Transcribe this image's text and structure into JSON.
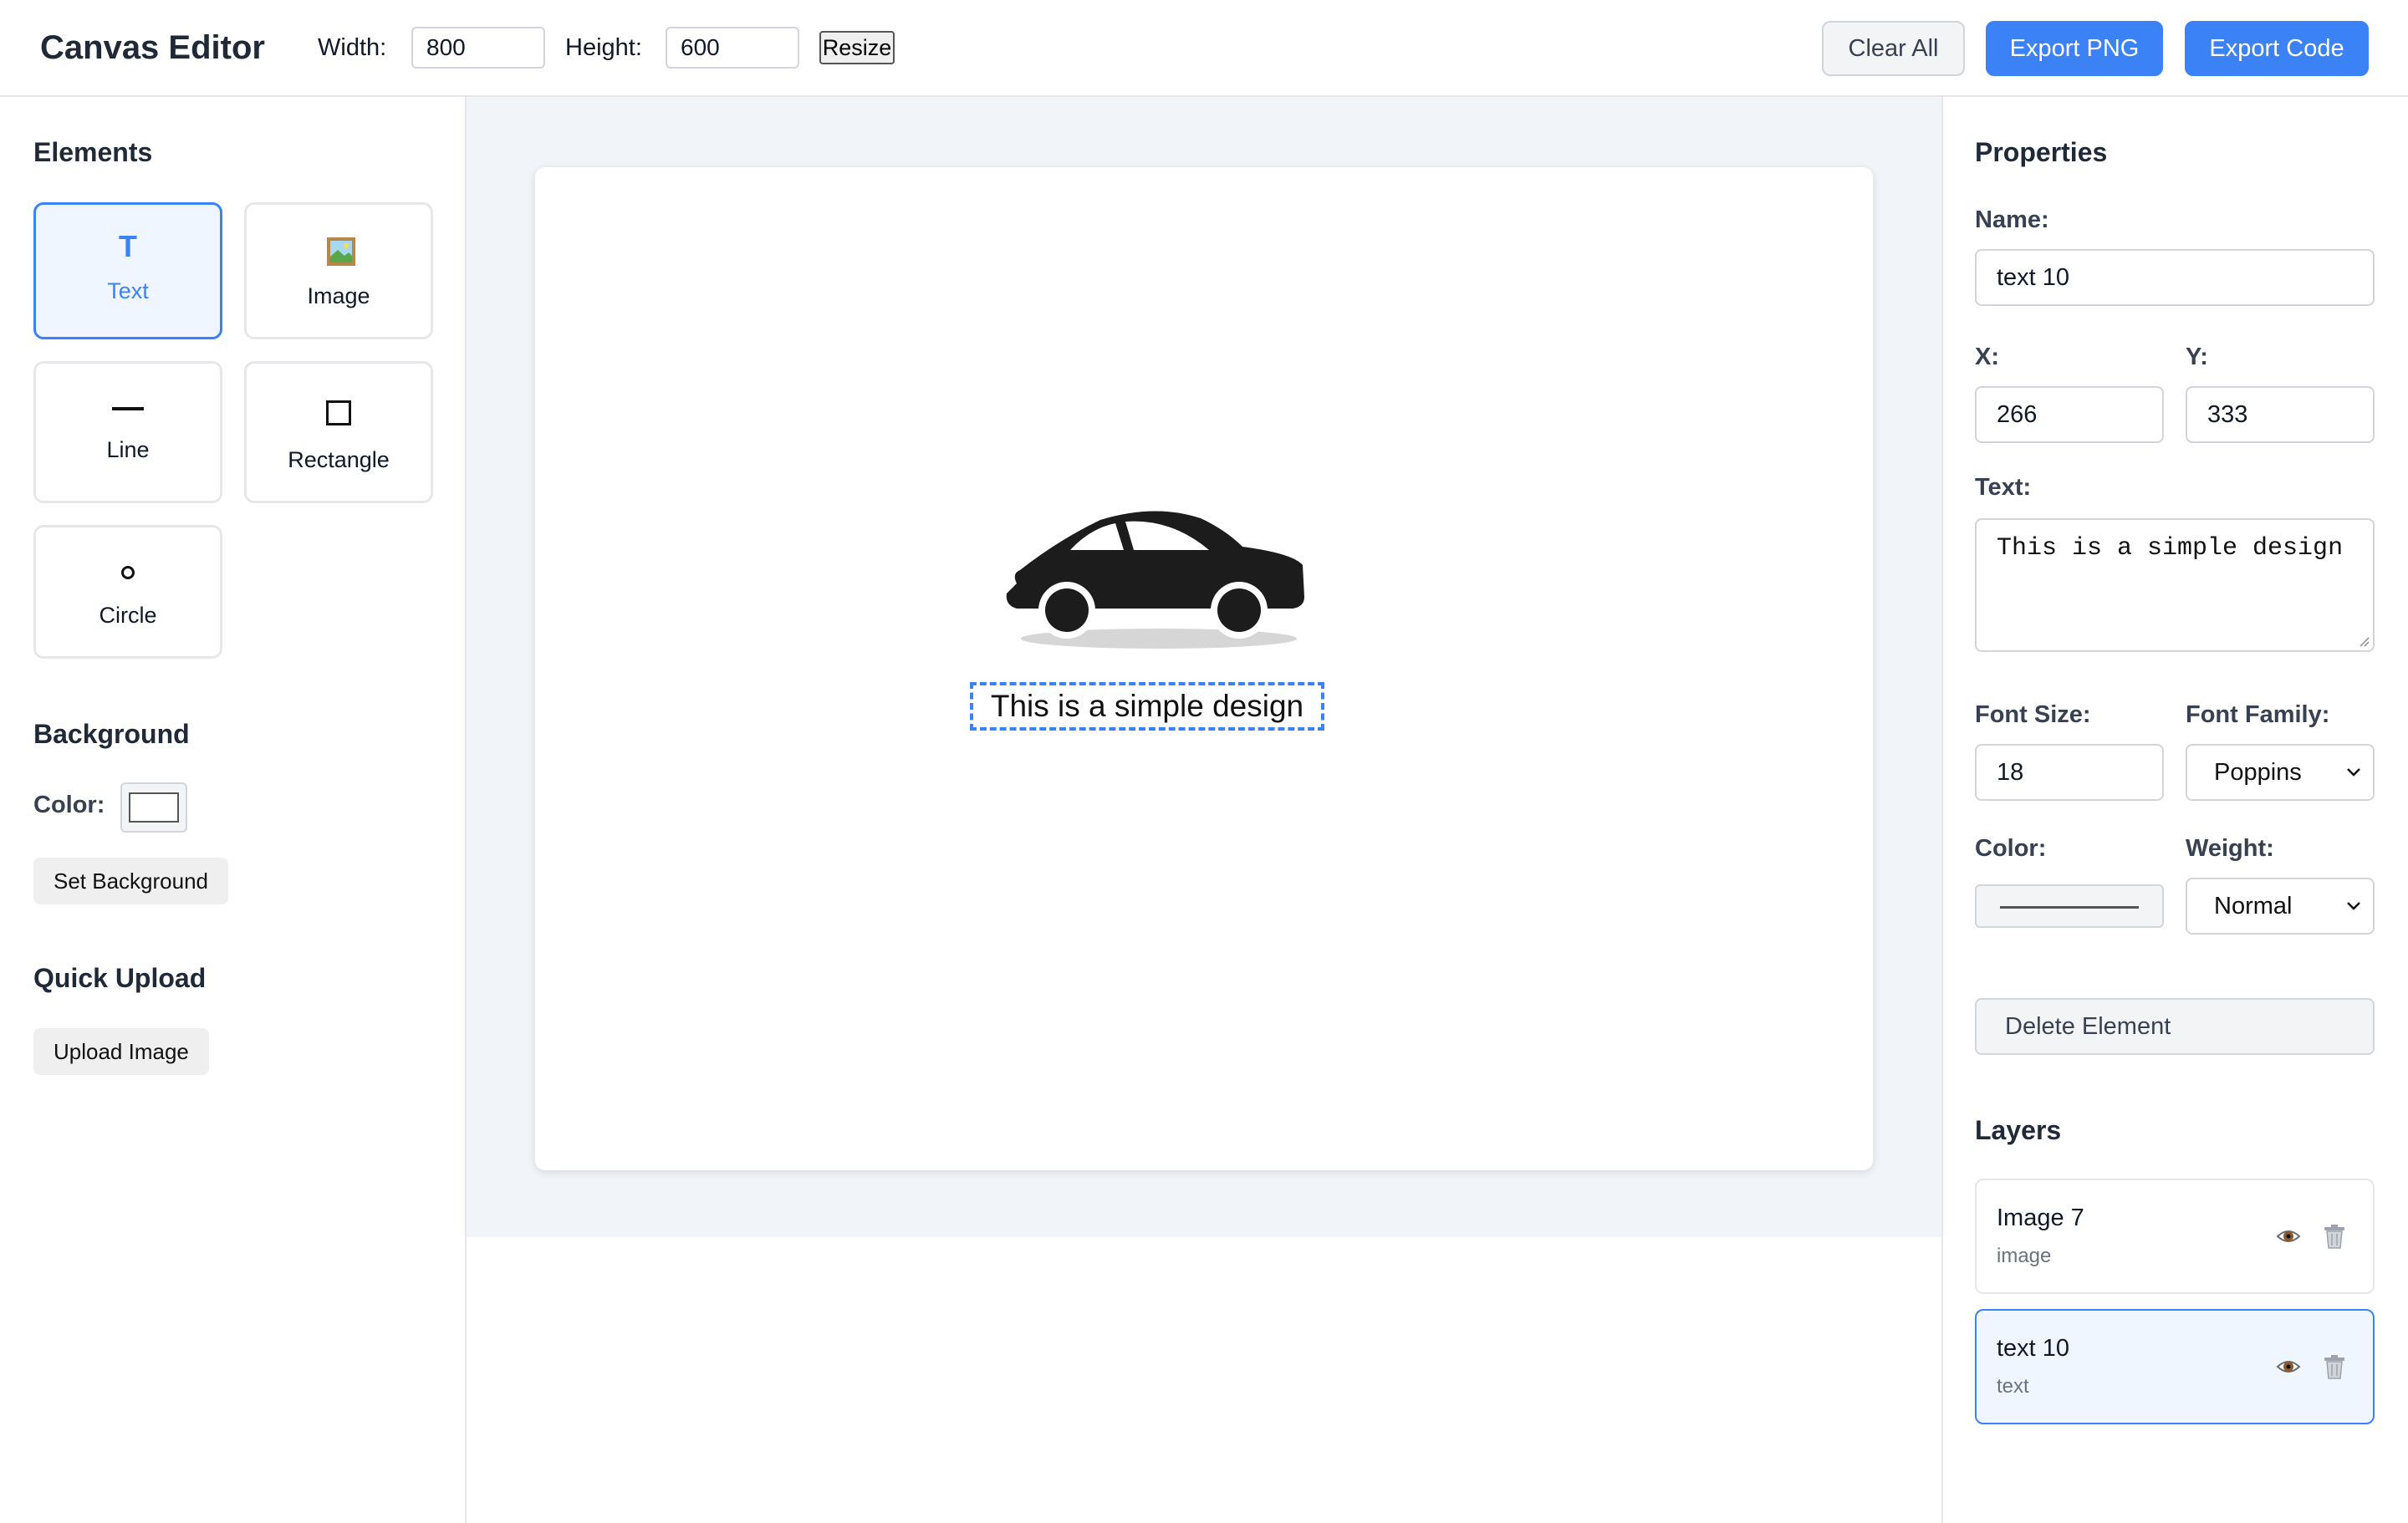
{
  "header": {
    "title": "Canvas Editor",
    "width_label": "Width:",
    "width_value": "800",
    "height_label": "Height:",
    "height_value": "600",
    "resize_label": "Resize",
    "clear_label": "Clear All",
    "export_png_label": "Export PNG",
    "export_code_label": "Export Code"
  },
  "elements": {
    "title": "Elements",
    "tools": [
      {
        "label": "Text",
        "icon": "text-icon",
        "active": true
      },
      {
        "label": "Image",
        "icon": "image-icon",
        "active": false
      },
      {
        "label": "Line",
        "icon": "line-icon",
        "active": false
      },
      {
        "label": "Rectangle",
        "icon": "rectangle-icon",
        "active": false
      },
      {
        "label": "Circle",
        "icon": "circle-icon",
        "active": false
      }
    ]
  },
  "background": {
    "title": "Background",
    "color_label": "Color:",
    "color_value": "#ffffff",
    "set_label": "Set Background"
  },
  "upload": {
    "title": "Quick Upload",
    "button_label": "Upload Image"
  },
  "canvas": {
    "image_icon": "car-icon",
    "selected_text": "This is a simple design"
  },
  "properties": {
    "title": "Properties",
    "name_label": "Name:",
    "name_value": "text 10",
    "x_label": "X:",
    "x_value": "266",
    "y_label": "Y:",
    "y_value": "333",
    "text_label": "Text:",
    "text_value": "This is a simple design",
    "font_size_label": "Font Size:",
    "font_size_value": "18",
    "font_family_label": "Font Family:",
    "font_family_value": "Poppins",
    "color_label": "Color:",
    "weight_label": "Weight:",
    "weight_value": "Normal",
    "delete_label": "Delete Element"
  },
  "layers": {
    "title": "Layers",
    "items": [
      {
        "name": "Image 7",
        "type": "image",
        "active": false
      },
      {
        "name": "text 10",
        "type": "text",
        "active": true
      }
    ]
  },
  "colors": {
    "accent": "#3b82f6",
    "accent_bg": "#eff6ff",
    "stage_bg": "#f1f4f8"
  }
}
